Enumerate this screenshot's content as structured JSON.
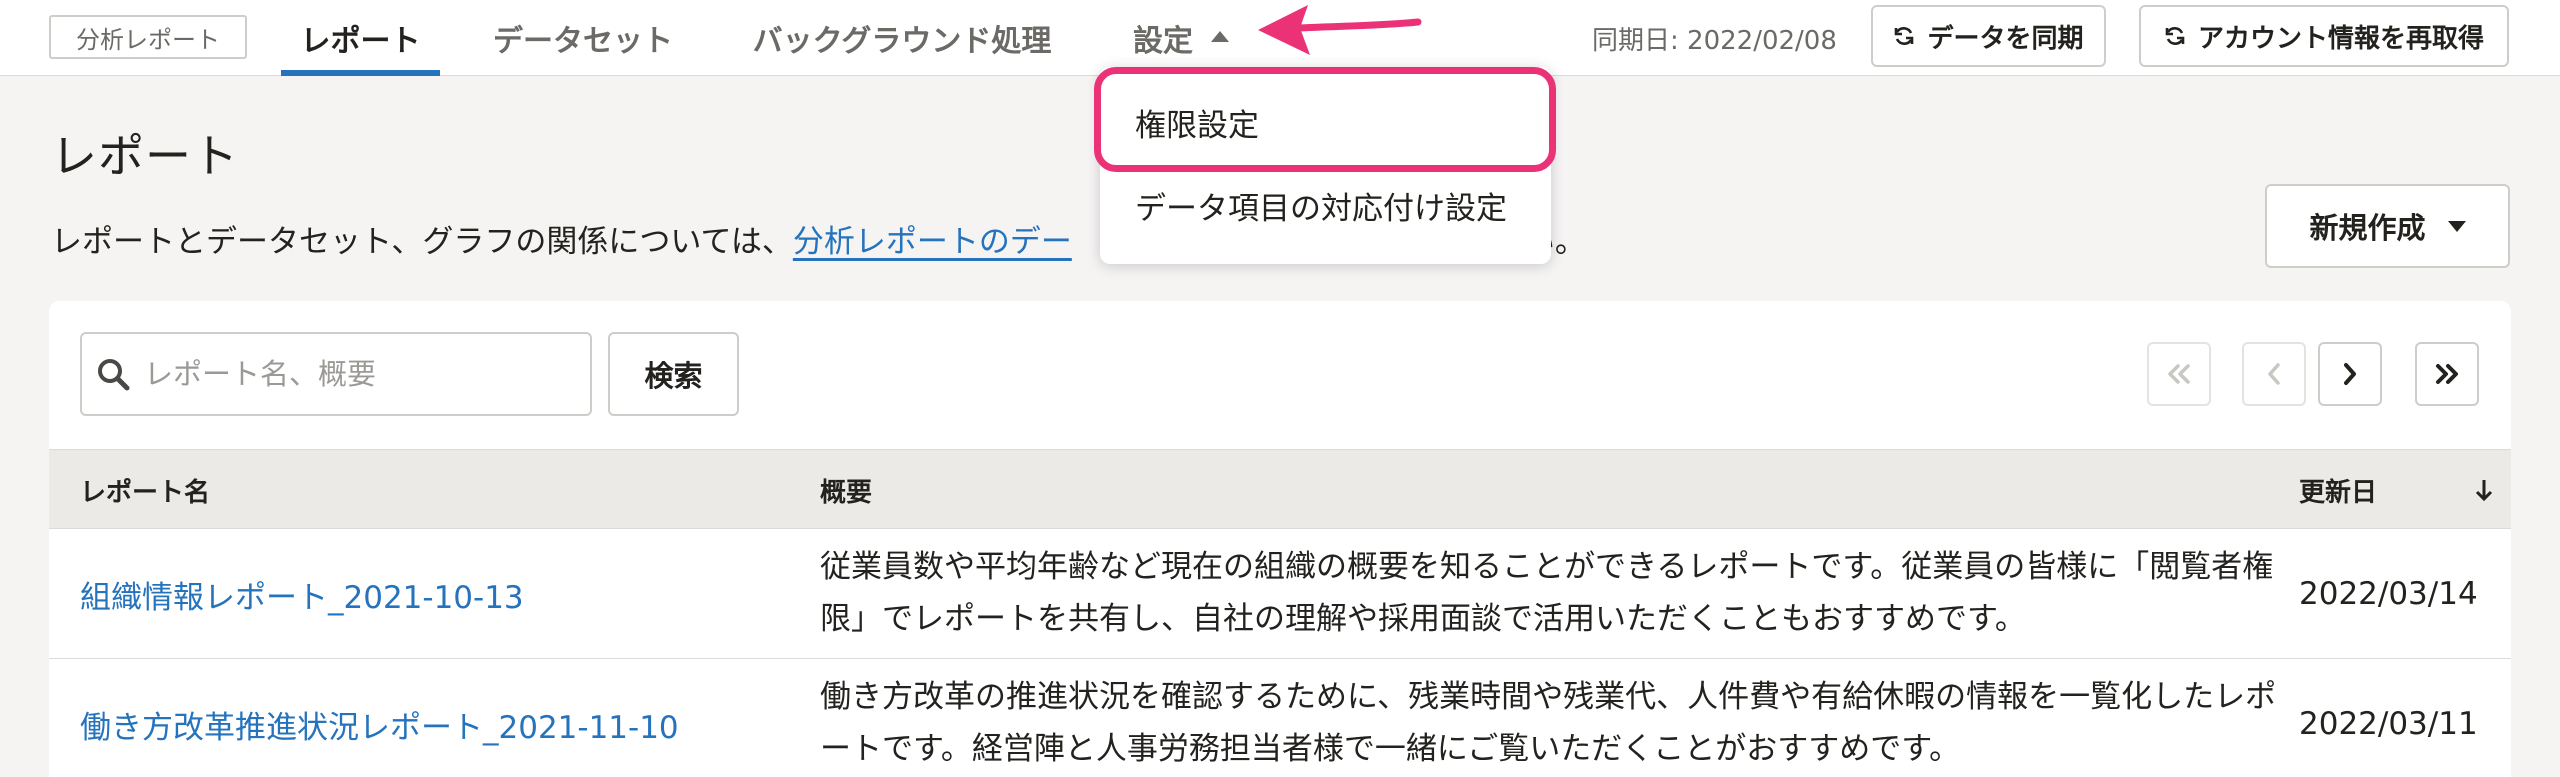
{
  "header": {
    "app_badge": "分析レポート",
    "tabs": [
      {
        "label": "レポート",
        "active": true
      },
      {
        "label": "データセット",
        "active": false
      },
      {
        "label": "バックグラウンド処理",
        "active": false
      },
      {
        "label": "設定",
        "active": false
      }
    ],
    "sync_date": "同期日: 2022/02/08",
    "sync_button": "データを同期",
    "refetch_button": "アカウント情報を再取得"
  },
  "settings_menu": {
    "items": [
      "権限設定",
      "データ項目の対応付け設定"
    ],
    "highlighted_item": "権限設定"
  },
  "page": {
    "title": "レポート",
    "description_prefix": "レポートとデータセット、グラフの関係については、",
    "description_link": "分析レポートのデー",
    "description_suffix": "い。",
    "new_button": "新規作成"
  },
  "search": {
    "placeholder": "レポート名、概要",
    "button": "検索"
  },
  "pager": {
    "first": "first-page-icon",
    "prev": "prev-page-icon",
    "next": "next-page-icon",
    "last": "last-page-icon"
  },
  "table": {
    "columns": [
      "レポート名",
      "概要",
      "更新日"
    ],
    "rows": [
      {
        "name": "組織情報レポート_2021-10-13",
        "description": "従業員数や平均年齢など現在の組織の概要を知ることができるレポートです。従業員の皆様に「閲覧者権限」でレポートを共有し、自社の理解や採用面談で活用いただくこともおすすめです。",
        "updated": "2022/03/14"
      },
      {
        "name": "働き方改革推進状況レポート_2021-11-10",
        "description": "働き方改革の推進状況を確認するために、残業時間や残業代、人件費や有給休暇の情報を一覧化したレポートです。経営陣と人事労務担当者様で一緒にご覧いただくことがおすすめです。",
        "updated": "2022/03/11"
      }
    ]
  },
  "colors": {
    "accent": "#2573bd",
    "annotation": "#ec3277",
    "background": "#f5f4f3",
    "table_header": "#eceae6"
  }
}
